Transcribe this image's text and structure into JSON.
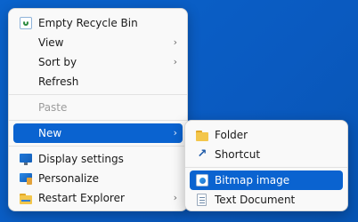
{
  "main_menu": {
    "items": [
      {
        "label": "Empty Recycle Bin"
      },
      {
        "label": "View"
      },
      {
        "label": "Sort by"
      },
      {
        "label": "Refresh"
      },
      {
        "label": "Paste"
      },
      {
        "label": "New"
      },
      {
        "label": "Display settings"
      },
      {
        "label": "Personalize"
      },
      {
        "label": "Restart Explorer"
      }
    ]
  },
  "submenu": {
    "items": [
      {
        "label": "Folder"
      },
      {
        "label": "Shortcut"
      },
      {
        "label": "Bitmap image"
      },
      {
        "label": "Text Document"
      }
    ]
  },
  "icons": {
    "recycle": "recycle-bin-icon",
    "display": "monitor-icon",
    "personalize": "personalize-icon",
    "explorer": "folder-icon",
    "folder": "folder-icon",
    "shortcut": "shortcut-arrow-icon",
    "bitmap": "bitmap-image-icon",
    "text": "text-document-icon",
    "chevron": "chevron-right-icon"
  },
  "colors": {
    "desktop": "#0a5ec4",
    "highlight": "#0a63d0",
    "menu_bg": "#f9f9f9"
  }
}
